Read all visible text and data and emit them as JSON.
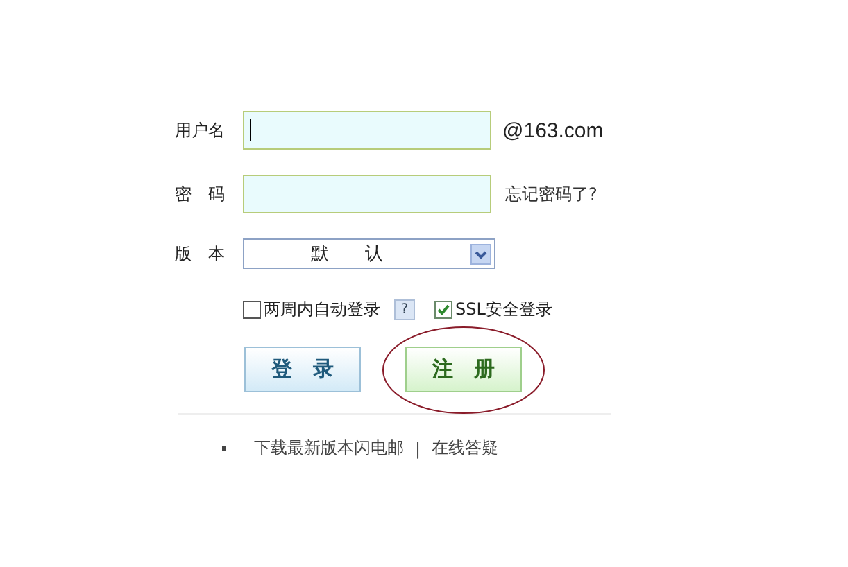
{
  "form": {
    "fields": [
      {
        "kind": "text",
        "label": "用户名",
        "suffix": "@163.com",
        "focused": true
      },
      {
        "kind": "password",
        "label": "密　码",
        "suffix": "忘记密码了?",
        "focused": false
      },
      {
        "kind": "select",
        "label": "版　本",
        "value": "默　　认"
      }
    ],
    "options": [
      {
        "label": "两周内自动登录",
        "checked": false,
        "help": "?"
      },
      {
        "label": "SSL安全登录",
        "checked": true
      }
    ],
    "buttons": [
      {
        "label": "登　录",
        "kind": "login",
        "circled": false
      },
      {
        "label": "注　册",
        "kind": "register",
        "circled": true
      }
    ]
  },
  "footer_links": [
    "下载最新版本闪电邮",
    "|",
    "在线答疑"
  ]
}
